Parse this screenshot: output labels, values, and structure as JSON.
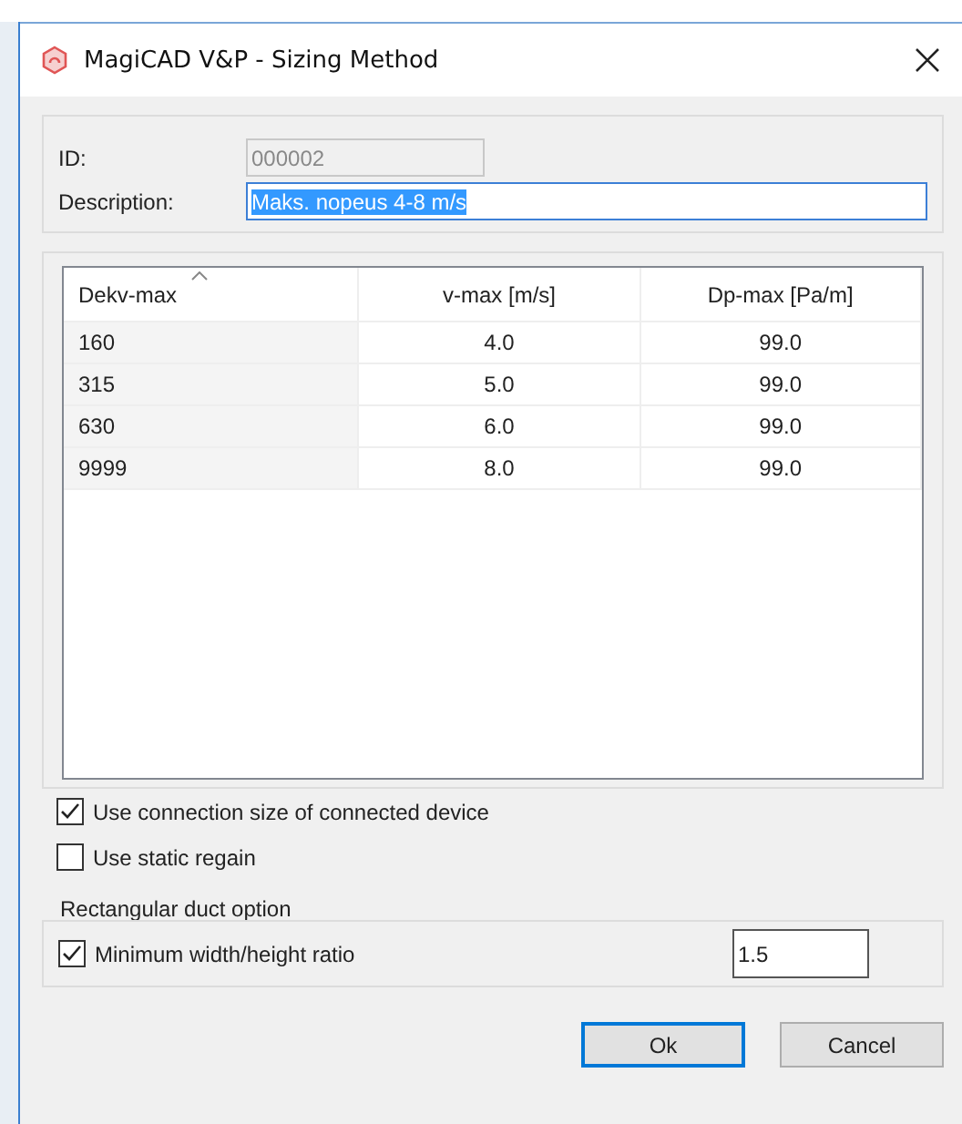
{
  "window": {
    "title": "MagiCAD V&P - Sizing Method"
  },
  "fields": [
    {
      "label": "ID:",
      "value": "000002",
      "disabled": true,
      "selected": false
    },
    {
      "label": "Description:",
      "value": "Maks. nopeus 4-8 m/s",
      "disabled": false,
      "selected": true
    }
  ],
  "table": {
    "columns": [
      {
        "label": "Dekv-max",
        "sorted": true
      },
      {
        "label": "v-max [m/s]",
        "sorted": false
      },
      {
        "label": "Dp-max [Pa/m]",
        "sorted": false
      }
    ],
    "rows": [
      [
        "160",
        "4.0",
        "99.0"
      ],
      [
        "315",
        "5.0",
        "99.0"
      ],
      [
        "630",
        "6.0",
        "99.0"
      ],
      [
        "9999",
        "8.0",
        "99.0"
      ]
    ]
  },
  "options": [
    {
      "label": "Use connection size of connected device",
      "checked": true
    },
    {
      "label": "Use static regain",
      "checked": false
    }
  ],
  "rect_group": {
    "title": "Rectangular duct option",
    "option": {
      "label": "Minimum width/height ratio",
      "checked": true
    },
    "value": "1.5"
  },
  "buttons": [
    {
      "label": "Ok",
      "default": true
    },
    {
      "label": "Cancel",
      "default": false
    }
  ]
}
